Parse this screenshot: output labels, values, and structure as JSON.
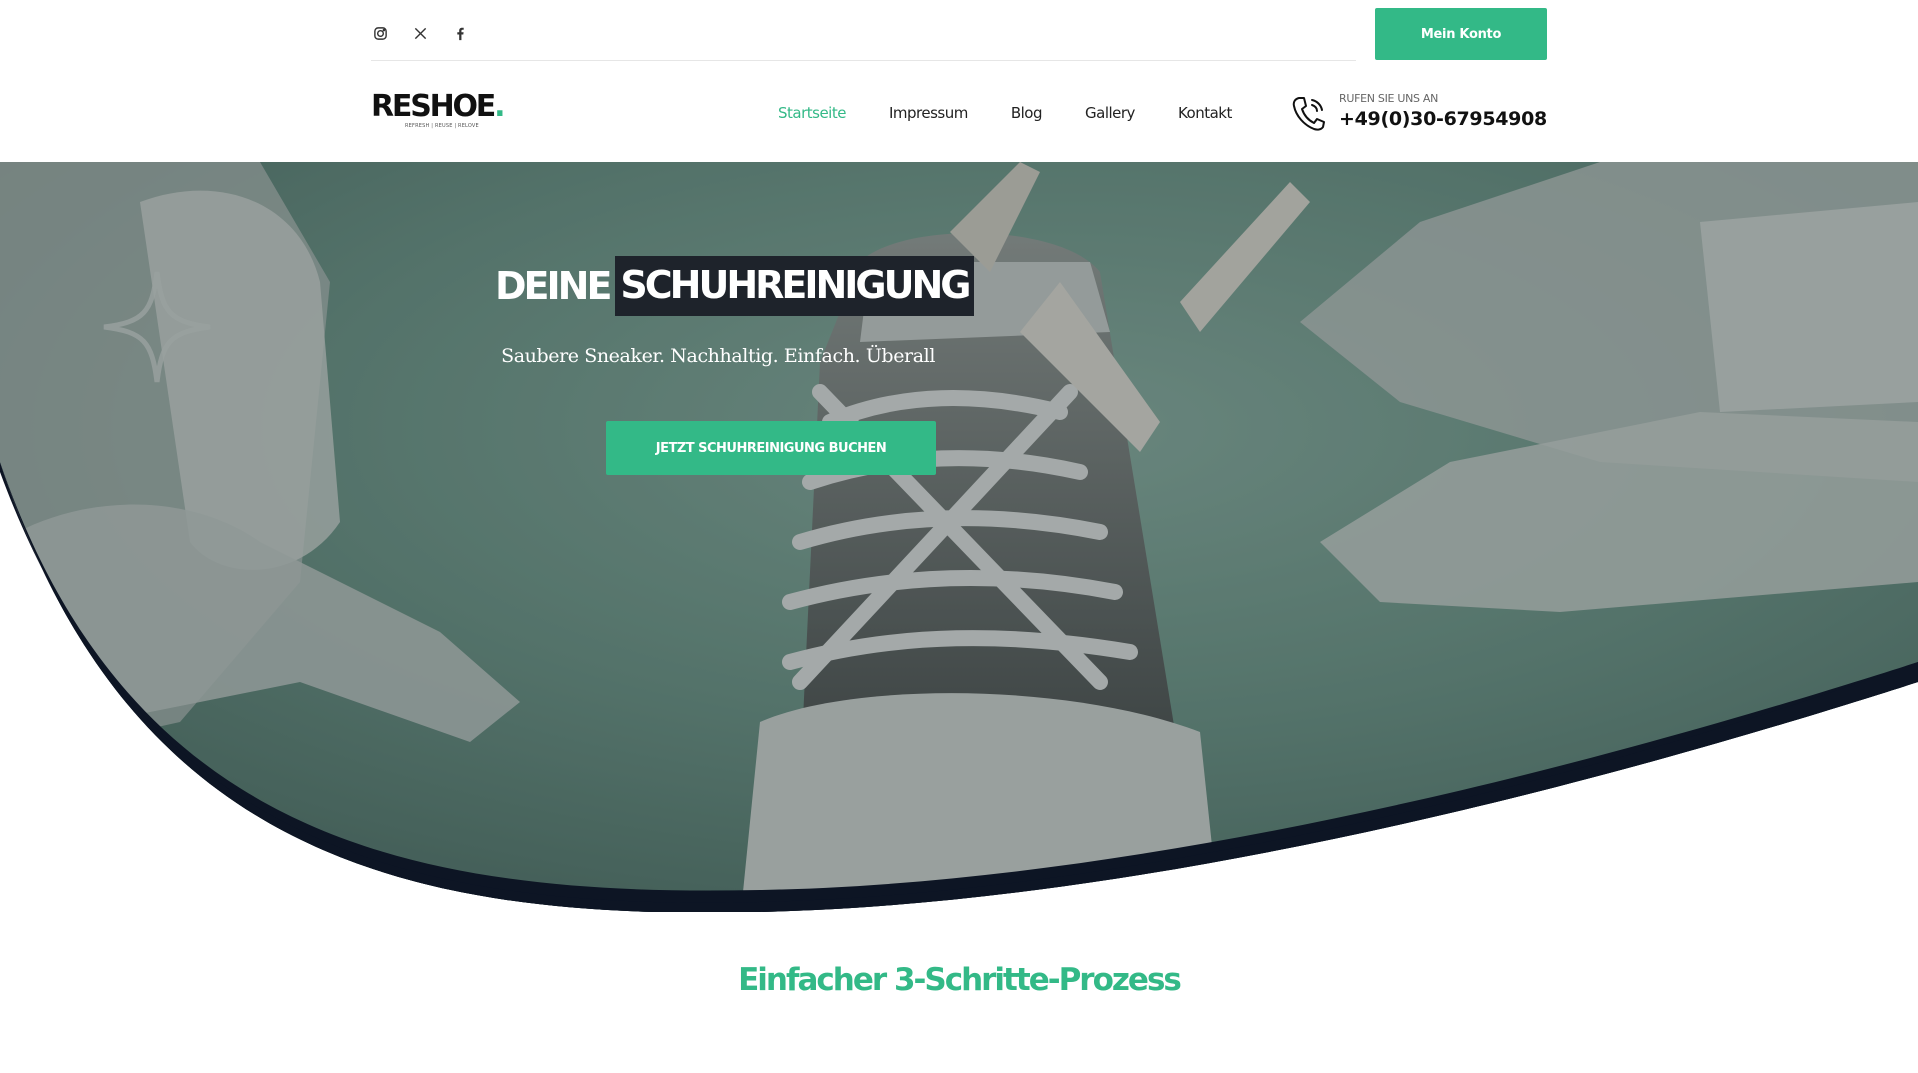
{
  "topbar": {
    "social_icons": [
      "instagram-icon",
      "x-icon",
      "facebook-icon"
    ],
    "account_button": "Mein Konto"
  },
  "header": {
    "logo_text": "RESHOE",
    "logo_dot": ".",
    "logo_tagline": "REFRESH | REUSE | RELOVE",
    "nav": [
      "Startseite",
      "Impressum",
      "Blog",
      "Gallery",
      "Kontakt"
    ],
    "active_nav": "Startseite",
    "phone_label": "RUFEN SIE UNS AN",
    "phone_number": "+49(0)30-67954908"
  },
  "hero": {
    "title_plain": "DEINE",
    "title_highlight": "SCHUHREINIGUNG",
    "subtitle": "Saubere Sneaker. Nachhaltig. Einfach. Überall",
    "cta": "JETZT SCHUHREINIGUNG BUCHEN"
  },
  "section": {
    "title": "Einfacher 3-Schritte-Prozess"
  },
  "colors": {
    "accent": "#33b987",
    "dark": "#0d1524",
    "title_highlight_bg": "#1e232b"
  }
}
